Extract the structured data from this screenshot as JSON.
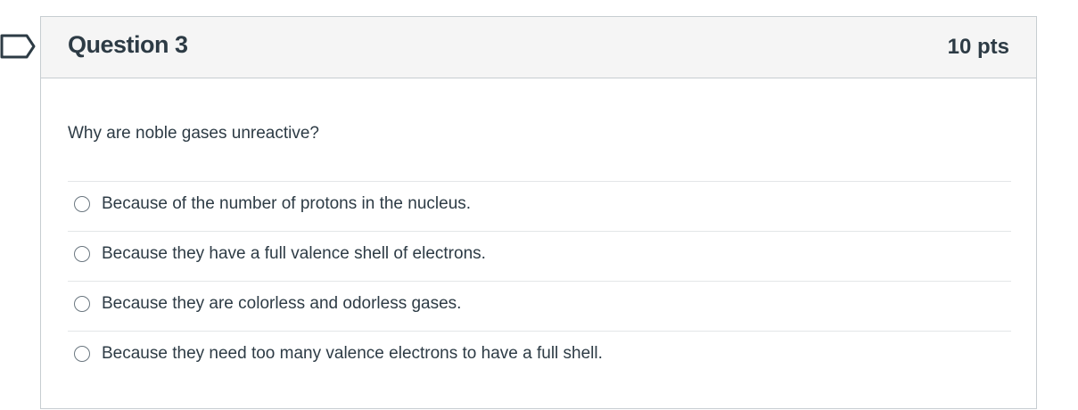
{
  "question": {
    "title": "Question 3",
    "points": "10 pts",
    "text": "Why are noble gases unreactive?",
    "answers": [
      {
        "label": "Because of the number of protons in the nucleus."
      },
      {
        "label": "Because they have a full valence shell of electrons."
      },
      {
        "label": "Because they are colorless and odorless gases."
      },
      {
        "label": "Because they need too many valence electrons to have a full shell."
      }
    ]
  },
  "flag": {
    "icon": "bookmark-flag-icon",
    "color": "#2d3b45"
  }
}
